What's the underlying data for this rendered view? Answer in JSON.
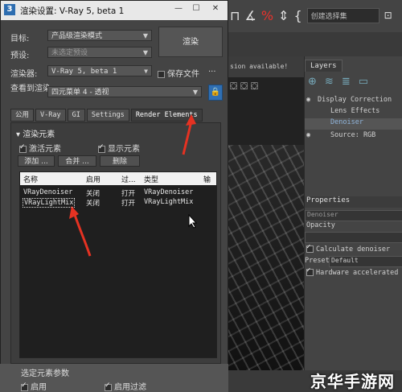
{
  "background": {
    "toolbar_icons": [
      "magnet-icon",
      "angle-snap-icon",
      "percent-snap-icon",
      "spinner-snap-icon",
      "edit-selection-icon"
    ],
    "selection_set": "创建选择集",
    "viewport_notice": "sion available!",
    "layers": {
      "tab": "Layers",
      "rows": [
        "Display Correction",
        "Lens Effects",
        "Denoiser",
        "Source: RGB"
      ],
      "properties_title": "Properties",
      "denoiser_field": "Denoiser",
      "opacity_label": "Opacity",
      "calculate_denoiser": "Calculate denoiser",
      "preset_label": "Preset",
      "preset_value": "Default",
      "hardware_accelerated": "Hardware accelerated"
    }
  },
  "dialog": {
    "app_icon": "3",
    "title": "渲染设置: V-Ray 5, beta 1",
    "target_label": "目标:",
    "target_value": "产品级渲染模式",
    "preset_label": "预设:",
    "preset_value": "未选定预设",
    "renderer_label": "渲染器:",
    "renderer_value": "V-Ray 5, beta 1",
    "save_file_label": "保存文件",
    "save_file_more": "...",
    "render_button": "渲染",
    "view_label": "查看到渲染:",
    "view_value": "四元菜单 4 - 透视",
    "tabs": [
      "公用",
      "V-Ray",
      "GI",
      "Settings",
      "Render Elements"
    ],
    "active_tab": "Render Elements",
    "rollout_title": "渲染元素",
    "activate_elements": "激活元素",
    "show_elements": "显示元素",
    "add_button": "添加 ...",
    "merge_button": "合并 ...",
    "delete_button": "删除",
    "list_columns": [
      "名称",
      "启用",
      "过...",
      "类型",
      "输"
    ],
    "list_rows": [
      {
        "name": "VRayDenoiser",
        "enabled": "关闭",
        "filter": "打开",
        "type": "VRayDenoiser"
      },
      {
        "name": "VRayLightMix",
        "enabled": "关闭",
        "filter": "打开",
        "type": "VRayLightMix"
      }
    ],
    "bottom_title": "选定元素参数",
    "bottom_enable": "启用",
    "bottom_filter": "启用过滤"
  },
  "watermark": "京华手游网",
  "colors": {
    "annotation_arrow": "#e53222",
    "titlebar": "#e8e8e8",
    "panel": "#3d3d3d"
  }
}
